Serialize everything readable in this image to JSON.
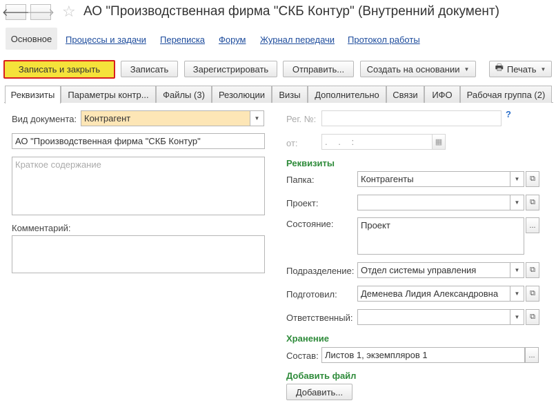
{
  "window": {
    "title": "АО \"Производственная фирма \"СКБ Контур\" (Внутренний документ)"
  },
  "nav": {
    "active": "Основное",
    "links": [
      "Процессы и задачи",
      "Переписка",
      "Форум",
      "Журнал передачи",
      "Протокол работы"
    ]
  },
  "toolbar": {
    "save_close": "Записать и закрыть",
    "save": "Записать",
    "register": "Зарегистрировать",
    "send": "Отправить...",
    "create_based": "Создать на основании",
    "print": "Печать"
  },
  "tabs": [
    "Реквизиты",
    "Параметры контр...",
    "Файлы (3)",
    "Резолюции",
    "Визы",
    "Дополнительно",
    "Связи",
    "ИФО",
    "Рабочая группа (2)"
  ],
  "left": {
    "doc_type_label": "Вид документа:",
    "doc_type_value": "Контрагент",
    "name_value": "АО \"Производственная фирма \"СКБ Контур\"",
    "summary_placeholder": "Краткое содержание",
    "comment_label": "Комментарий:"
  },
  "right": {
    "reg_label": "Рег. №:",
    "help": "?",
    "date_label": "от:",
    "date_mask": ". .   :",
    "requisites_header": "Реквизиты",
    "folder_label": "Папка:",
    "folder_value": "Контрагенты",
    "project_label": "Проект:",
    "project_value": "",
    "state_label": "Состояние:",
    "state_value": "Проект",
    "division_label": "Подразделение:",
    "division_value": "Отдел системы управления",
    "prepared_label": "Подготовил:",
    "prepared_value": "Деменева Лидия Александровна",
    "responsible_label": "Ответственный:",
    "responsible_value": "",
    "storage_header": "Хранение",
    "composition_label": "Состав:",
    "composition_value": "Листов 1, экземпляров 1",
    "add_file_header": "Добавить файл",
    "add_button": "Добавить..."
  },
  "icons": {
    "back": "arrow-left-icon",
    "forward": "arrow-right-icon",
    "favorite": "star-icon",
    "print": "printer-icon",
    "calendar": "calendar-icon",
    "dropdown": "chevron-down-icon",
    "open": "open-window-icon",
    "ellipsis": "ellipsis-icon"
  },
  "colors": {
    "primary_button": "#f5e23a",
    "primary_border": "#d81e1e",
    "link": "#1c4b9c",
    "section_header": "#2e8b3a",
    "highlight_field": "#fde6b6"
  }
}
